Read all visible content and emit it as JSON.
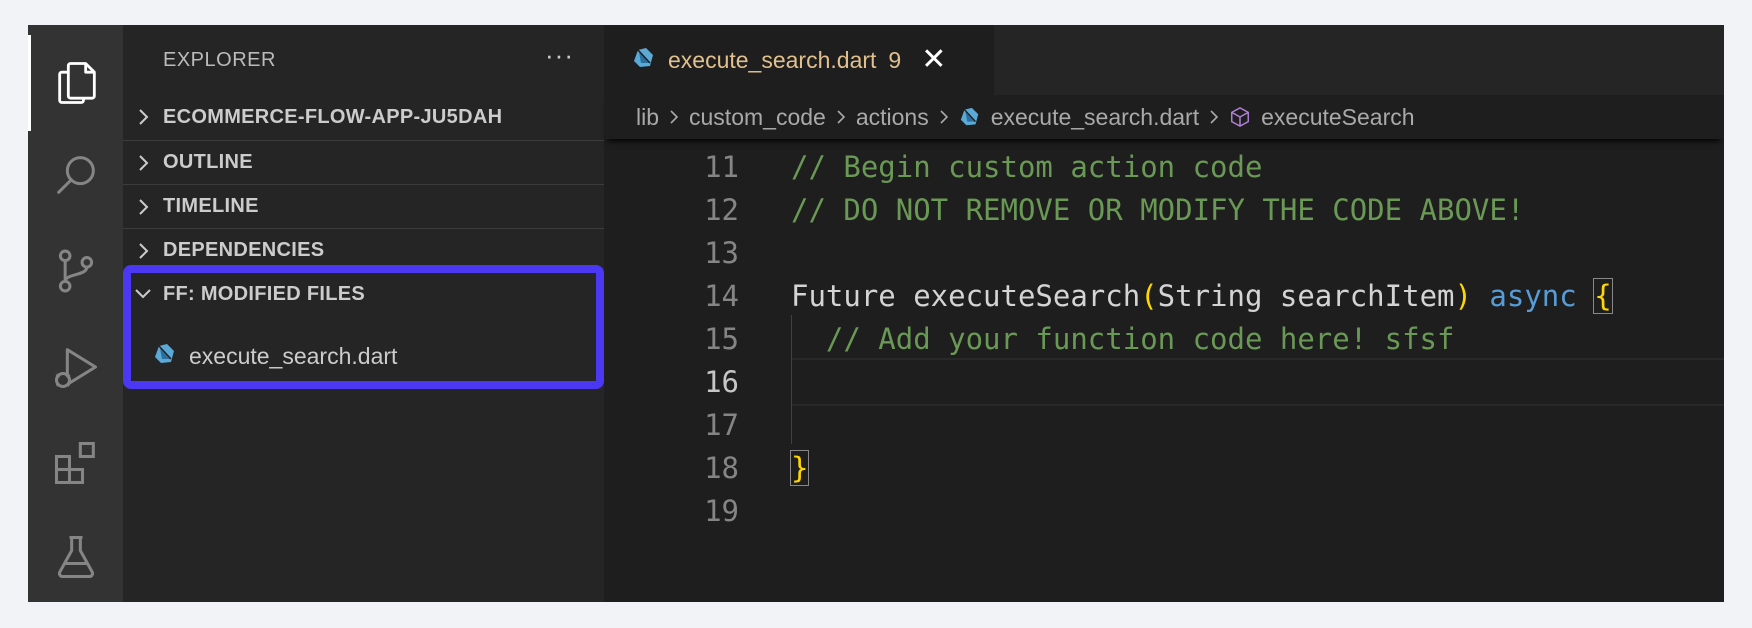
{
  "activity_bar": {
    "items": [
      {
        "icon": "files-icon",
        "active": true
      },
      {
        "icon": "search-icon",
        "active": false
      },
      {
        "icon": "source-control-icon",
        "active": false
      },
      {
        "icon": "run-debug-icon",
        "active": false
      },
      {
        "icon": "extensions-icon",
        "active": false
      },
      {
        "icon": "testing-flask-icon",
        "active": false
      }
    ]
  },
  "sidebar": {
    "title": "EXPLORER",
    "more_label": "···",
    "sections": [
      {
        "label": "ECOMMERCE-FLOW-APP-JU5DAH",
        "expanded": false
      },
      {
        "label": "OUTLINE",
        "expanded": false
      },
      {
        "label": "TIMELINE",
        "expanded": false
      },
      {
        "label": "DEPENDENCIES",
        "expanded": false
      },
      {
        "label": "FF: MODIFIED FILES",
        "expanded": true
      }
    ],
    "modified_files": [
      {
        "name": "execute_search.dart",
        "icon": "dart-file-icon"
      }
    ],
    "highlight_color": "#4a38f2"
  },
  "editor": {
    "tab": {
      "name": "execute_search.dart",
      "problems": "9",
      "close": "✕"
    },
    "breadcrumb": [
      "lib",
      "custom_code",
      "actions",
      "execute_search.dart",
      "executeSearch"
    ],
    "lines": [
      {
        "n": "11",
        "tokens": [
          {
            "t": "// Begin custom action code",
            "c": "cmt"
          }
        ]
      },
      {
        "n": "12",
        "tokens": [
          {
            "t": "// DO NOT REMOVE OR MODIFY THE CODE ABOVE!",
            "c": "cmt"
          }
        ]
      },
      {
        "n": "13",
        "tokens": []
      },
      {
        "n": "14",
        "tokens": [
          {
            "t": "Future executeSearch",
            "c": "plain"
          },
          {
            "t": "(",
            "c": "brace"
          },
          {
            "t": "String searchItem",
            "c": "plain"
          },
          {
            "t": ")",
            "c": "brace"
          },
          {
            "t": " ",
            "c": "plain"
          },
          {
            "t": "async",
            "c": "kw"
          },
          {
            "t": " ",
            "c": "plain"
          },
          {
            "t": "{",
            "c": "brace-box"
          }
        ]
      },
      {
        "n": "15",
        "tokens": [
          {
            "t": "  // Add your function code here! sfsf",
            "c": "cmt"
          }
        ]
      },
      {
        "n": "16",
        "tokens": [],
        "current": true
      },
      {
        "n": "17",
        "tokens": []
      },
      {
        "n": "18",
        "tokens": [
          {
            "t": "}",
            "c": "brace-box"
          }
        ]
      },
      {
        "n": "19",
        "tokens": []
      }
    ],
    "colors": {
      "comment": "#6a9955",
      "keyword": "#569cd6",
      "bracket": "#ffd700",
      "tab_modified": "#e2c08d"
    }
  }
}
